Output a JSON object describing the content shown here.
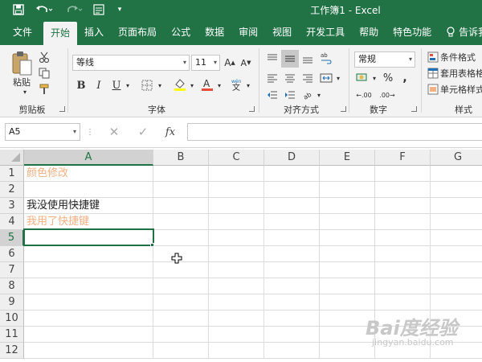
{
  "window": {
    "title": "工作簿1  -  Excel"
  },
  "colors": {
    "accent": "#217346",
    "orange_text": "#f4b183"
  },
  "ribbon_tabs": [
    "文件",
    "开始",
    "插入",
    "页面布局",
    "公式",
    "数据",
    "审阅",
    "视图",
    "开发工具",
    "帮助",
    "特色功能",
    "告诉我"
  ],
  "active_tab": "开始",
  "clipboard": {
    "paste_label": "粘贴",
    "group_label": "剪贴板"
  },
  "font": {
    "name": "等线",
    "size": "11",
    "group_label": "字体"
  },
  "alignment": {
    "group_label": "对齐方式"
  },
  "number": {
    "format": "常规",
    "group_label": "数字"
  },
  "styles": {
    "conditional": "条件格式",
    "table": "套用表格格式",
    "cell": "单元格样式",
    "group_label": "样式"
  },
  "formula_bar": {
    "name_box": "A5",
    "fx": "fx",
    "content": ""
  },
  "columns": [
    "A",
    "B",
    "C",
    "D",
    "E",
    "F",
    "G"
  ],
  "rows": [
    "1",
    "2",
    "3",
    "4",
    "5",
    "6",
    "7",
    "8",
    "9",
    "10",
    "11",
    "12"
  ],
  "selected": {
    "column": "A",
    "row": "5"
  },
  "cells": {
    "A1": "颜色修改",
    "A3": "我没使用快捷键",
    "A4": "我用了快捷键"
  },
  "watermark": {
    "brand": "Bai度经验",
    "url": "jingyan.baidu.com"
  }
}
